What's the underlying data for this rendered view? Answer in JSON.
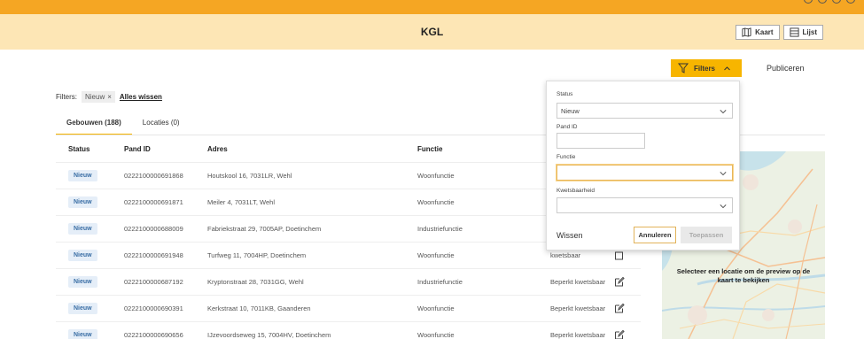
{
  "header": {
    "title": "KGL",
    "view_buttons": [
      {
        "label": "Kaart",
        "icon": "map-icon"
      },
      {
        "label": "Lijst",
        "icon": "list-icon"
      }
    ]
  },
  "toolbar": {
    "filters_label": "Filters",
    "publish_label": "Publiceren"
  },
  "active_filters": {
    "label": "Filters:",
    "chips": [
      {
        "label": "Nieuw"
      }
    ],
    "clear_all_label": "Alles wissen"
  },
  "tabs": [
    {
      "label": "Gebouwen (188)",
      "active": true
    },
    {
      "label": "Locaties (0)",
      "active": false
    }
  ],
  "table": {
    "columns": [
      "Status",
      "Pand ID",
      "Adres",
      "Functie"
    ],
    "rows": [
      {
        "status": "Nieuw",
        "pand_id": "0222100000691868",
        "adres": "Houtskool 16, 7031LR, Wehl",
        "functie": "Woonfunctie",
        "kwetsbaar": ""
      },
      {
        "status": "Nieuw",
        "pand_id": "0222100000691871",
        "adres": "Meiler 4, 7031LT, Wehl",
        "functie": "Woonfunctie",
        "kwetsbaar": ""
      },
      {
        "status": "Nieuw",
        "pand_id": "0222100000688009",
        "adres": "Fabriekstraat 29, 7005AP, Doetinchem",
        "functie": "Industriefunctie",
        "kwetsbaar": ""
      },
      {
        "status": "Nieuw",
        "pand_id": "0222100000691948",
        "adres": "Turfweg 11, 7004HP, Doetinchem",
        "functie": "Woonfunctie",
        "kwetsbaar": "kwetsbaar"
      },
      {
        "status": "Nieuw",
        "pand_id": "0222100000687192",
        "adres": "Kryptonstraat 28, 7031GG, Wehl",
        "functie": "Industriefunctie",
        "kwetsbaar": "Beperkt kwetsbaar"
      },
      {
        "status": "Nieuw",
        "pand_id": "0222100000690391",
        "adres": "Kerkstraat 10, 7011KB, Gaanderen",
        "functie": "Woonfunctie",
        "kwetsbaar": "Beperkt kwetsbaar"
      },
      {
        "status": "Nieuw",
        "pand_id": "0222100000690656",
        "adres": "IJzevoordseweg 15, 7004HV, Doetinchem",
        "functie": "Woonfunctie",
        "kwetsbaar": "Beperkt kwetsbaar"
      }
    ]
  },
  "map": {
    "message": "Selecteer een locatie om de preview op de kaart te bekijken"
  },
  "filter_panel": {
    "status_label": "Status",
    "status_value": "Nieuw",
    "pand_id_label": "Pand ID",
    "pand_id_value": "",
    "functie_label": "Functie",
    "functie_value": "",
    "kwetsbaarheid_label": "Kwetsbaarheid",
    "kwetsbaarheid_value": "",
    "clear_label": "Wissen",
    "cancel_label": "Annuleren",
    "apply_label": "Toepassen"
  },
  "colors": {
    "accent": "#f7b500",
    "header_bg": "#fde6b5",
    "top_strip": "#f5a623",
    "badge_bg": "#e5eef8",
    "badge_text": "#3a6ea5"
  }
}
